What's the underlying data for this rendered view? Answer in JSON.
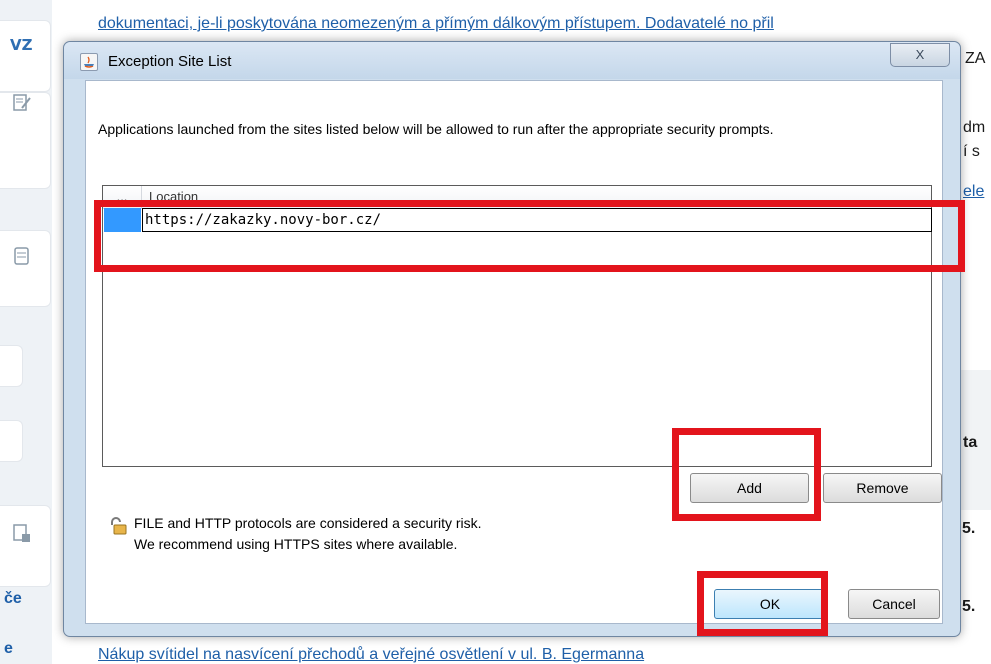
{
  "background": {
    "top_line": "dokumentaci, je-li poskytována neomezeným a přímým dálkovým přístupem. Dodavatelé no přil",
    "sidebar_label": "VZ",
    "right_fragments": [
      "ZA",
      "dm",
      "í s",
      "ele",
      "ta",
      "5.",
      "5."
    ],
    "left_fragments": [
      "če",
      "e"
    ],
    "bottom_link": "Nákup svítidel na nasvícení přechodů a veřejné osvětlení v ul. B. Egermanna"
  },
  "dialog": {
    "title": "Exception Site List",
    "close_glyph": "X",
    "description": "Applications launched from the sites listed below will be allowed to run after the appropriate security prompts.",
    "table": {
      "columns": [
        "...",
        "Location"
      ],
      "rows": [
        {
          "location": "https://zakazky.novy-bor.cz/"
        }
      ]
    },
    "add_label": "Add",
    "remove_label": "Remove",
    "warning_line1": "FILE and HTTP protocols are considered a security risk.",
    "warning_line2": "We recommend using HTTPS sites where available.",
    "ok_label": "OK",
    "cancel_label": "Cancel"
  },
  "colors": {
    "highlight": "#e3141c",
    "selection": "#3399ff",
    "link": "#1e5fa8"
  }
}
